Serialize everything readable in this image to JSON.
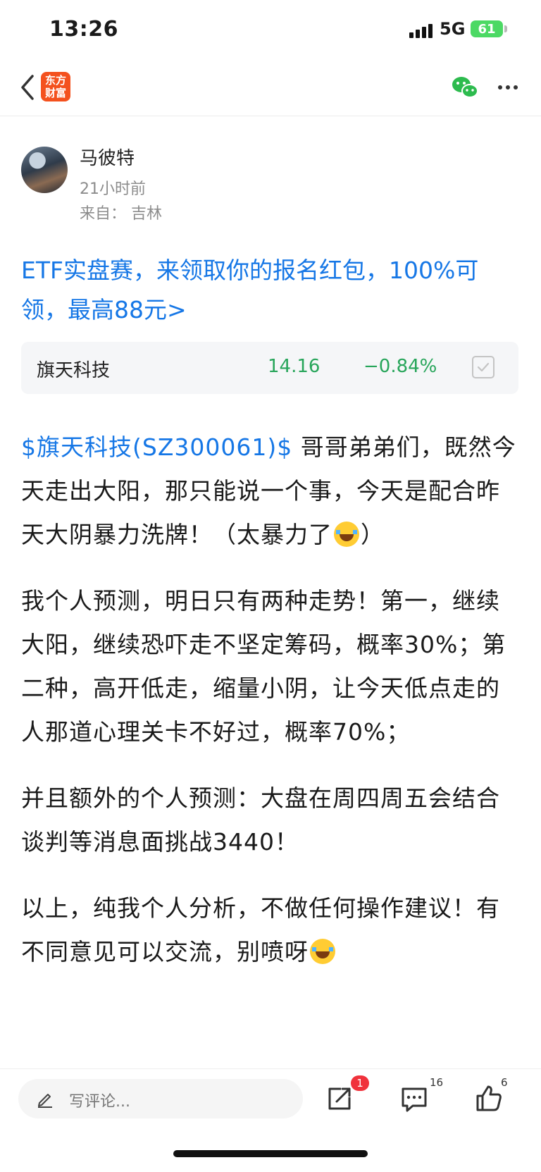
{
  "status_bar": {
    "time": "13:26",
    "network": "5G",
    "battery": "61"
  },
  "nav": {
    "logo_line1": "东方",
    "logo_line2": "财富"
  },
  "author": {
    "name": "马彼特",
    "time": "21小时前",
    "location": "来自：  吉林"
  },
  "promo": {
    "text": "ETF实盘赛，来领取你的报名红包，100%可领，最高88元>"
  },
  "stock": {
    "name": "旗天科技",
    "price": "14.16",
    "change": "−0.84%",
    "color": "#27a55a"
  },
  "post": {
    "tag": "$旗天科技(SZ300061)$",
    "p1_text": " 哥哥弟弟们，既然今天走出大阳，那只能说一个事，今天是配合昨天大阴暴力洗牌！（太暴力了",
    "p1_end": "）",
    "p2": "我个人预测，明日只有两种走势！第一，继续大阳，继续恐吓走不坚定筹码，概率30%；第二种，高开低走，缩量小阴，让今天低点走的人那道心理关卡不好过，概率70%；",
    "p3": "并且额外的个人预测：大盘在周四周五会结合谈判等消息面挑战3440！",
    "p4": "以上，纯我个人分析，不做任何操作建议！有不同意见可以交流，别喷呀"
  },
  "bottom_bar": {
    "comment_placeholder": "写评论...",
    "share_badge": "1",
    "reply_count": "16",
    "like_count": "6"
  },
  "colors": {
    "link": "#1677e6",
    "down": "#27a55a",
    "brand": "#f4511e",
    "badge": "#f0323c"
  }
}
